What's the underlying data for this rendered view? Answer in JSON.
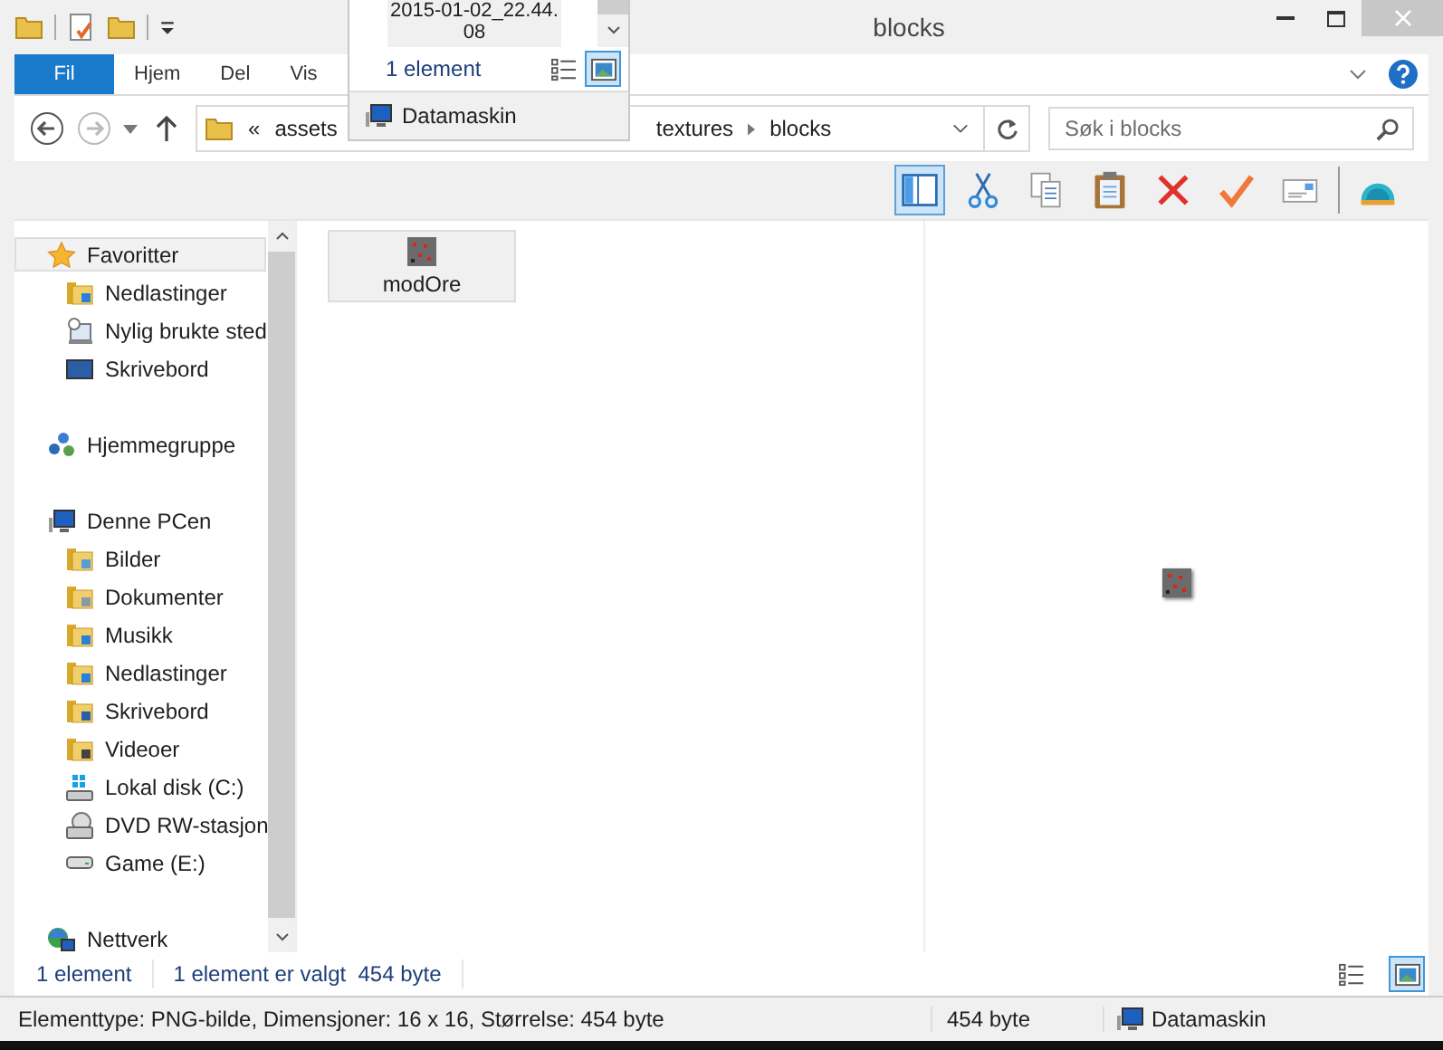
{
  "title": "blocks",
  "quick_access": [
    {
      "kind": "folder"
    },
    {
      "kind": "properties"
    },
    {
      "kind": "new-folder"
    },
    {
      "kind": "customize"
    }
  ],
  "ribbon_tabs": [
    {
      "label": "Fil",
      "selected": true
    },
    {
      "label": "Hjem",
      "selected": false
    },
    {
      "label": "Del",
      "selected": false
    },
    {
      "label": "Vis",
      "selected": false
    }
  ],
  "address": {
    "overflow": "«",
    "crumbs": [
      "assets",
      "textures",
      "blocks"
    ]
  },
  "search": {
    "placeholder": "Søk i blocks"
  },
  "toolbar": [
    {
      "kind": "preview-pane",
      "selected": true
    },
    {
      "kind": "cut",
      "selected": false
    },
    {
      "kind": "copy",
      "selected": false
    },
    {
      "kind": "paste",
      "selected": false
    },
    {
      "kind": "delete",
      "selected": false
    },
    {
      "kind": "rename",
      "selected": false
    },
    {
      "kind": "properties",
      "selected": false
    },
    {
      "kind": "shell",
      "selected": false
    }
  ],
  "nav": [
    {
      "label": "Favoritter",
      "kind": "star",
      "selected": true,
      "children": [
        {
          "label": "Nedlastinger",
          "kind": "folder-download",
          "selected": false
        },
        {
          "label": "Nylig brukte sted",
          "kind": "recent",
          "selected": false
        },
        {
          "label": "Skrivebord",
          "kind": "desktop",
          "selected": false
        }
      ]
    },
    {
      "label": "Hjemmegruppe",
      "kind": "homegroup",
      "selected": false
    },
    {
      "label": "Denne PCen",
      "kind": "pc",
      "selected": false,
      "children": [
        {
          "label": "Bilder",
          "kind": "folder-pictures",
          "selected": false
        },
        {
          "label": "Dokumenter",
          "kind": "folder-docs",
          "selected": false
        },
        {
          "label": "Musikk",
          "kind": "folder-music",
          "selected": false
        },
        {
          "label": "Nedlastinger",
          "kind": "folder-download",
          "selected": false
        },
        {
          "label": "Skrivebord",
          "kind": "folder-desktop",
          "selected": false
        },
        {
          "label": "Videoer",
          "kind": "folder-videos",
          "selected": false
        },
        {
          "label": "Lokal disk (C:)",
          "kind": "drive-windows",
          "selected": false
        },
        {
          "label": "DVD RW-stasjon",
          "kind": "dvd",
          "selected": false
        },
        {
          "label": "Game (E:)",
          "kind": "drive",
          "selected": false
        }
      ]
    },
    {
      "label": "Nettverk",
      "kind": "network",
      "selected": false
    }
  ],
  "files": [
    {
      "name": "modOre",
      "selected": true
    }
  ],
  "status": {
    "count": "1 element",
    "selection": "1 element er valgt  454 byte",
    "views": [
      {
        "kind": "details",
        "selected": false
      },
      {
        "kind": "large",
        "selected": true
      }
    ]
  },
  "details_bar": {
    "info": "Elementtype: PNG-bilde, Dimensjoner: 16 x 16, Størrelse: 454 byte",
    "size": "454 byte",
    "location": "Datamaskin"
  },
  "overlay_window": {
    "file_name_lines": [
      "2015-01-02_22.44.",
      "08"
    ],
    "status": "1 element",
    "views": [
      {
        "kind": "details",
        "selected": false
      },
      {
        "kind": "large",
        "selected": true
      }
    ],
    "location": "Datamaskin"
  }
}
